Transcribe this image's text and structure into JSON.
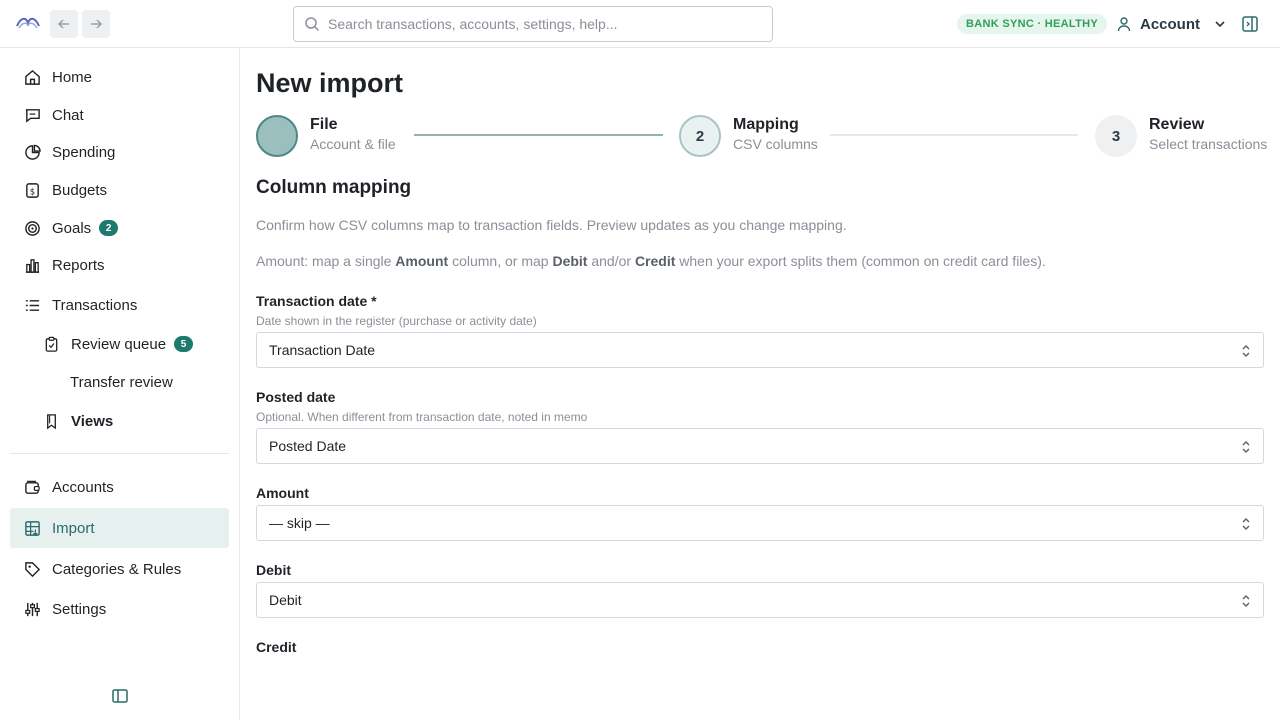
{
  "topbar": {
    "search_placeholder": "Search transactions, accounts, settings, help...",
    "sync_status": "BANK SYNC · HEALTHY",
    "account_label": "Account"
  },
  "sidebar": {
    "items": [
      {
        "label": "Home",
        "icon": "home-icon"
      },
      {
        "label": "Chat",
        "icon": "chat-icon"
      },
      {
        "label": "Spending",
        "icon": "pie-chart-icon"
      },
      {
        "label": "Budgets",
        "icon": "budget-icon"
      },
      {
        "label": "Goals",
        "icon": "target-icon",
        "badge": "2"
      },
      {
        "label": "Reports",
        "icon": "bar-chart-icon"
      },
      {
        "label": "Transactions",
        "icon": "list-icon"
      },
      {
        "label": "Review queue",
        "icon": "clipboard-icon",
        "badge": "5"
      },
      {
        "label": "Transfer review"
      },
      {
        "label": "Views",
        "icon": "bookmark-icon"
      },
      {
        "label": "Accounts",
        "icon": "wallet-icon"
      },
      {
        "label": "Import",
        "icon": "table-icon"
      },
      {
        "label": "Categories & Rules",
        "icon": "tag-icon"
      },
      {
        "label": "Settings",
        "icon": "sliders-icon"
      }
    ],
    "active": "Import"
  },
  "main": {
    "title": "New import",
    "steps": [
      {
        "title": "File",
        "subtitle": "Account & file",
        "number": "",
        "state": "done"
      },
      {
        "title": "Mapping",
        "subtitle": "CSV columns",
        "number": "2",
        "state": "current"
      },
      {
        "title": "Review",
        "subtitle": "Select transactions",
        "number": "3",
        "state": "todo"
      }
    ],
    "section_title": "Column mapping",
    "intro": "Confirm how CSV columns map to transaction fields. Preview updates as you change mapping.",
    "amount_note": {
      "p1": "Amount: map a single ",
      "b1": "Amount",
      "p2": " column, or map ",
      "b2": "Debit",
      "p3": " and/or ",
      "b3": "Credit",
      "p4": " when your export splits them (common on credit card files)."
    },
    "fields": {
      "transaction_date": {
        "label": "Transaction date *",
        "help": "Date shown in the register (purchase or activity date)",
        "value": "Transaction Date"
      },
      "posted_date": {
        "label": "Posted date",
        "help": "Optional. When different from transaction date, noted in memo",
        "value": "Posted Date"
      },
      "amount": {
        "label": "Amount",
        "value": "— skip —"
      },
      "debit": {
        "label": "Debit",
        "value": "Debit"
      },
      "credit": {
        "label": "Credit"
      }
    }
  },
  "colors": {
    "accent": "#1f7a6e",
    "active_bg": "#e6f0ef",
    "sync_green": "#2f9e5b"
  }
}
